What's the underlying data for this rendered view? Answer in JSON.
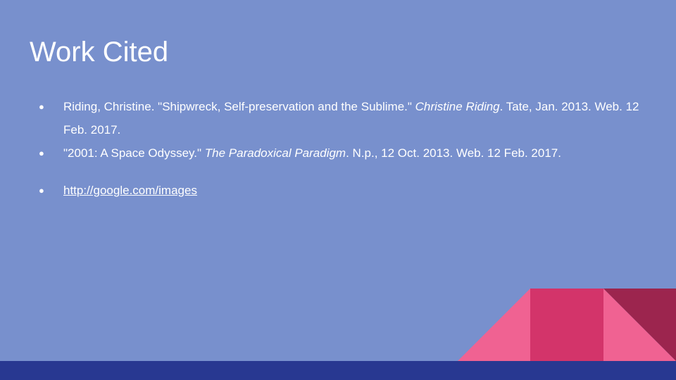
{
  "slide": {
    "title": "Work Cited",
    "citations": [
      {
        "pre": "Riding, Christine. \"Shipwreck, Self-preservation and the Sublime.\" ",
        "italic": "Christine Riding",
        "post": ". Tate, Jan. 2013. Web. 12 Feb. 2017."
      },
      {
        "pre": "\"2001: A Space Odyssey.\" ",
        "italic": "The Paradoxical Paradigm",
        "post": ". N.p., 12 Oct. 2013. Web. 12 Feb. 2017."
      }
    ],
    "link": "http://google.com/images",
    "bullet": "●"
  },
  "colors": {
    "background": "#7890cd",
    "footer": "#283891",
    "pink": "#f06292",
    "magenta": "#d3346a",
    "maroon": "#9c254e"
  }
}
